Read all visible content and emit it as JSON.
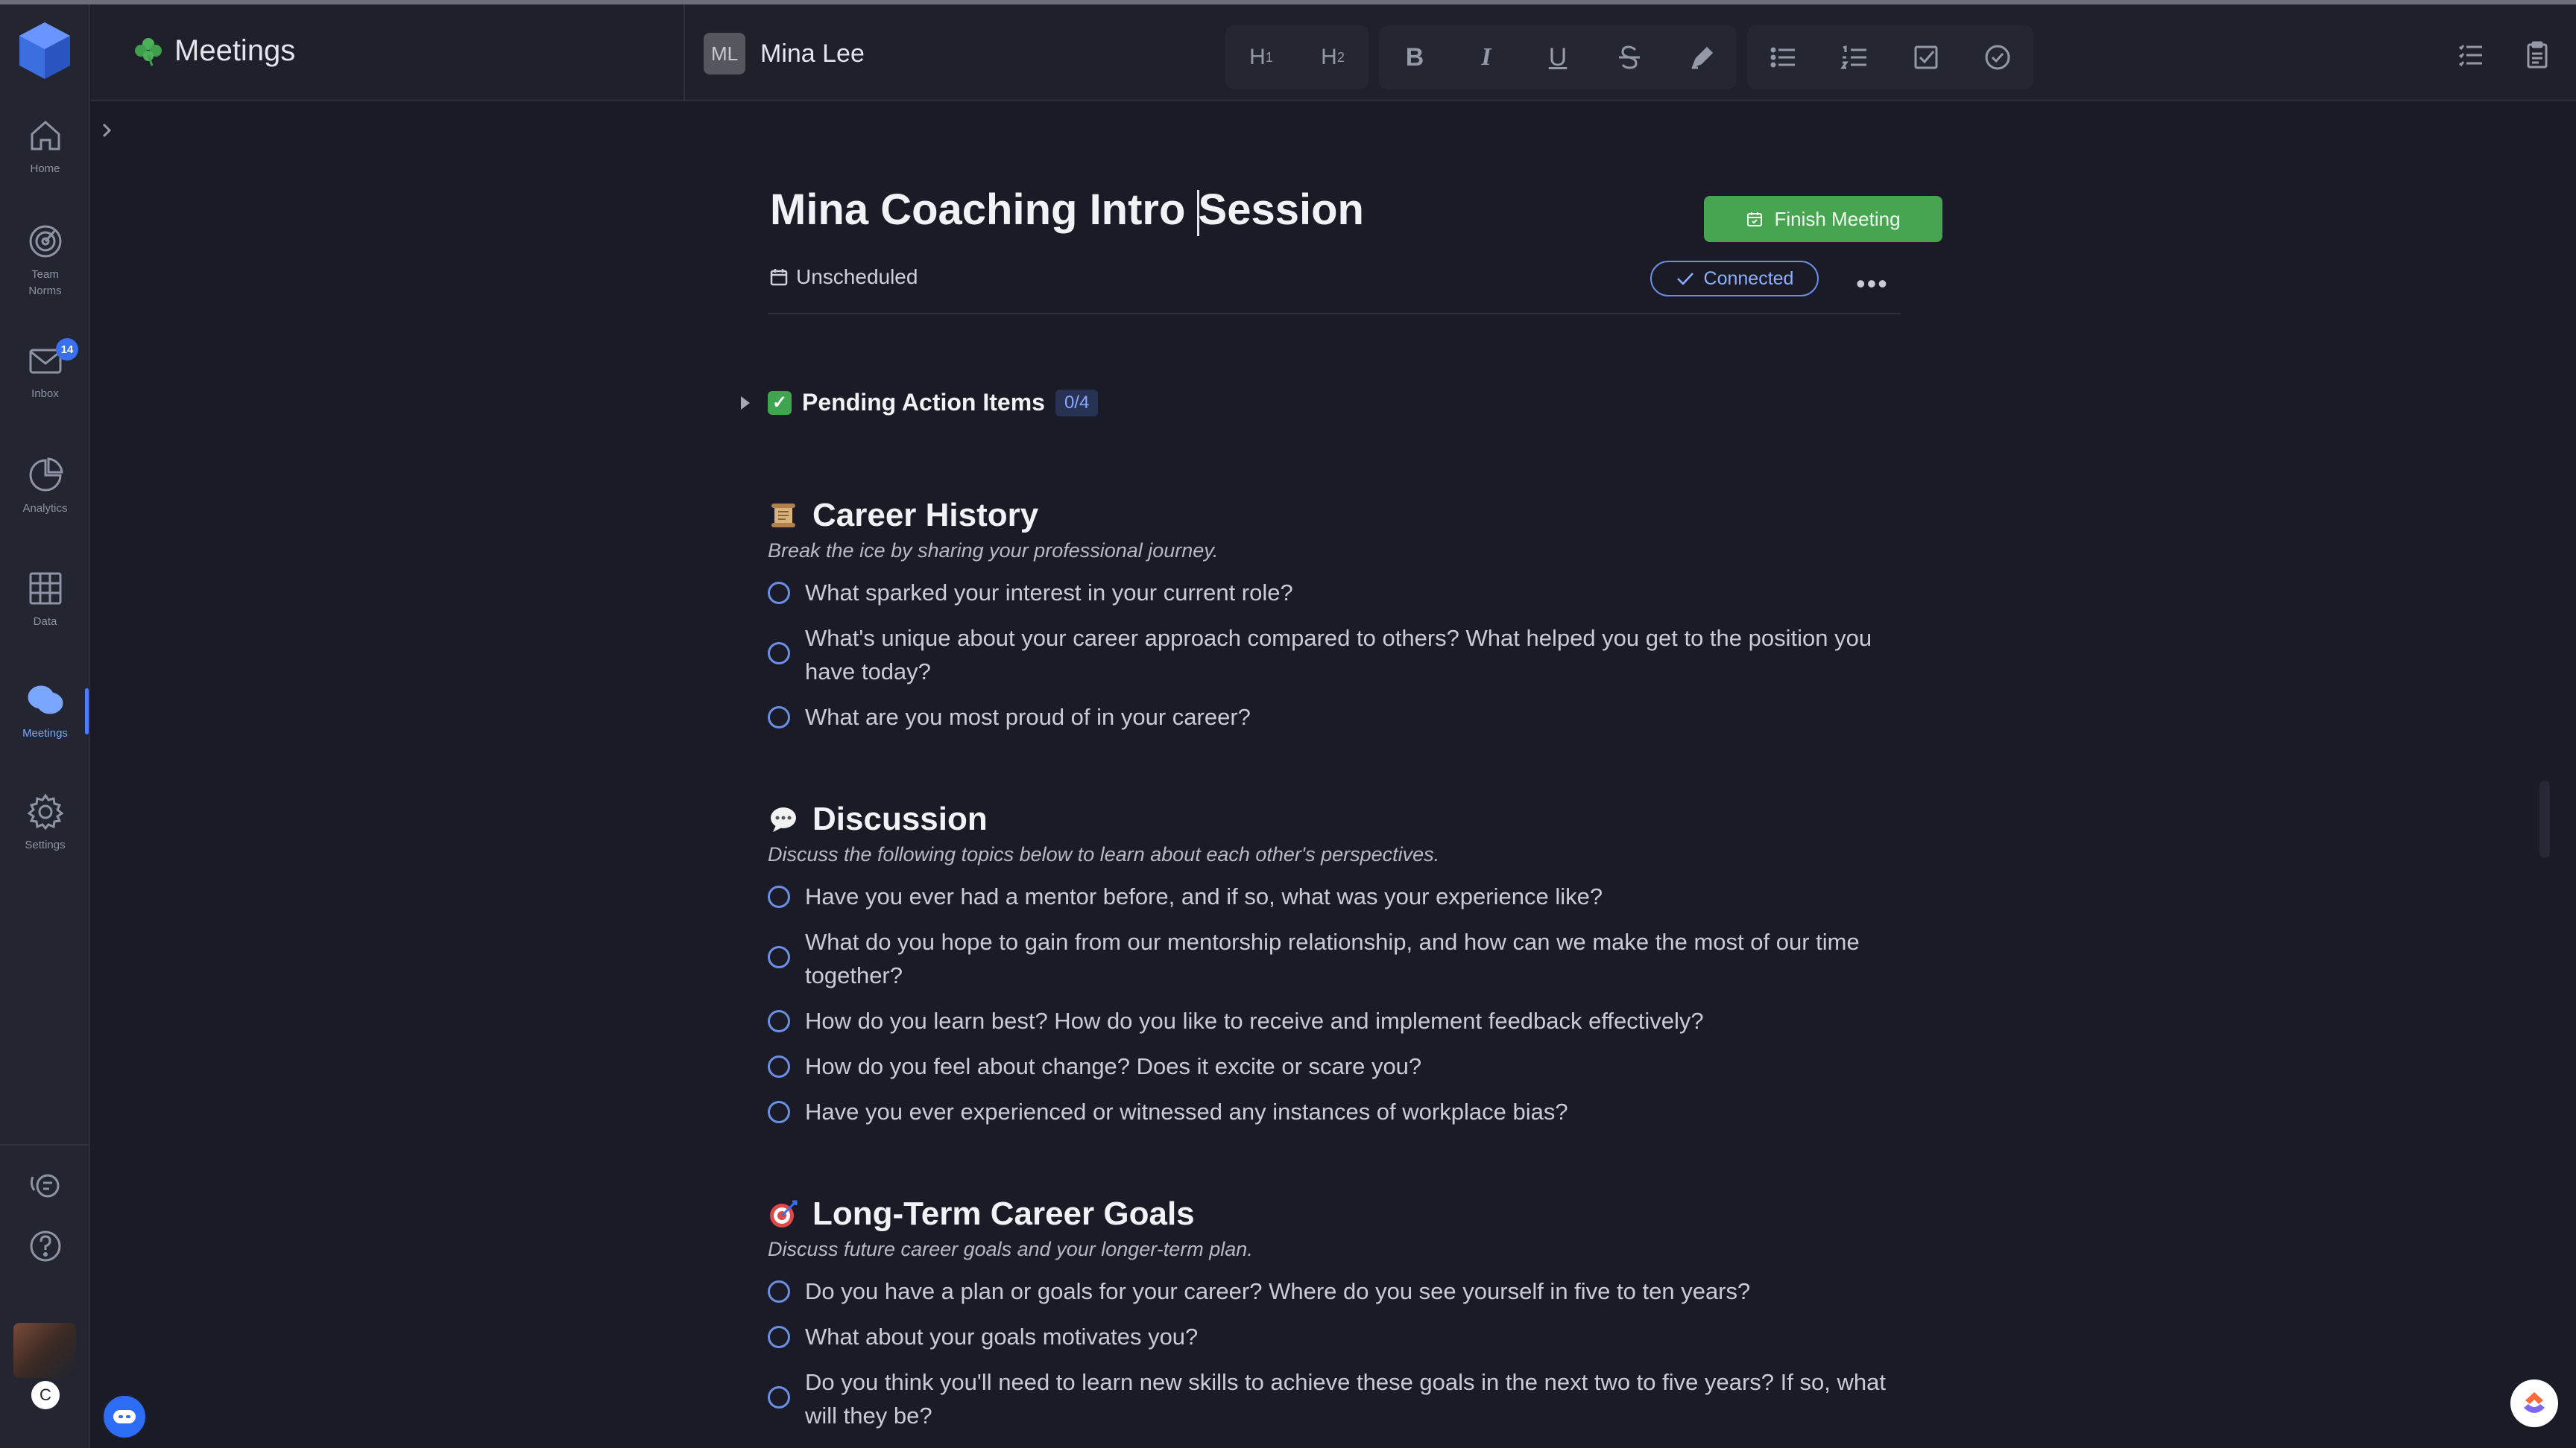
{
  "header": {
    "app_title": "Meetings",
    "person_initials": "ML",
    "person_name": "Mina Lee",
    "toolbar": {
      "h1_label": "H",
      "h1_sub": "1",
      "h2_label": "H",
      "h2_sub": "2",
      "bold_label": "B",
      "italic_label": "I",
      "underline_label": "U"
    }
  },
  "sidebar": {
    "items": [
      {
        "label": "Home",
        "icon": "home-icon"
      },
      {
        "label": "Team\nNorms",
        "label_line1": "Team",
        "label_line2": "Norms",
        "icon": "target-icon"
      },
      {
        "label": "Inbox",
        "icon": "mail-icon",
        "badge": "14"
      },
      {
        "label": "Analytics",
        "icon": "pie-chart-icon"
      },
      {
        "label": "Data",
        "icon": "table-icon"
      },
      {
        "label": "Meetings",
        "icon": "chat-bubbles-icon",
        "active": true
      },
      {
        "label": "Settings",
        "icon": "gear-icon"
      }
    ],
    "user_initial": "C",
    "active_color": "#7aa6ff"
  },
  "meeting": {
    "title_part1": "Mina Coaching Intro ",
    "title_part2": "Session",
    "finish_label": "Finish Meeting",
    "schedule_label": "Unscheduled",
    "connected_label": "Connected",
    "more_label": "•••",
    "pending_label": "Pending Action Items",
    "pending_count": "0/4",
    "finish_color": "#47a552"
  },
  "sections": [
    {
      "title": "Career History",
      "icon": "scroll-icon",
      "subtitle": "Break the ice by sharing your professional journey.",
      "questions": [
        "What sparked your interest in your current role?",
        "What's unique about your career approach compared to others? What helped you get to the position you have today?",
        "What are you most proud of in your career?"
      ]
    },
    {
      "title": "Discussion",
      "icon": "speech-bubble-icon",
      "subtitle": "Discuss the following topics below to learn about each other's perspectives.",
      "questions": [
        "Have you ever had a mentor before, and if so, what was your experience like?",
        "What do you hope to gain from our mentorship relationship, and how can we make the most of our time together?",
        "How do you learn best? How do you like to receive and implement feedback effectively?",
        "How do you feel about change? Does it excite or scare you?",
        "Have you ever experienced or witnessed any instances of workplace bias?"
      ]
    },
    {
      "title": "Long-Term Career Goals",
      "icon": "dart-target-icon",
      "subtitle": "Discuss future career goals and your longer-term plan.",
      "questions": [
        "Do you have a plan or goals for your career? Where do you see yourself in five to ten years?",
        "What about your goals motivates you?",
        "Do you think you'll need to learn new skills to achieve these goals in the next two to five years? If so, what will they be?"
      ]
    }
  ]
}
